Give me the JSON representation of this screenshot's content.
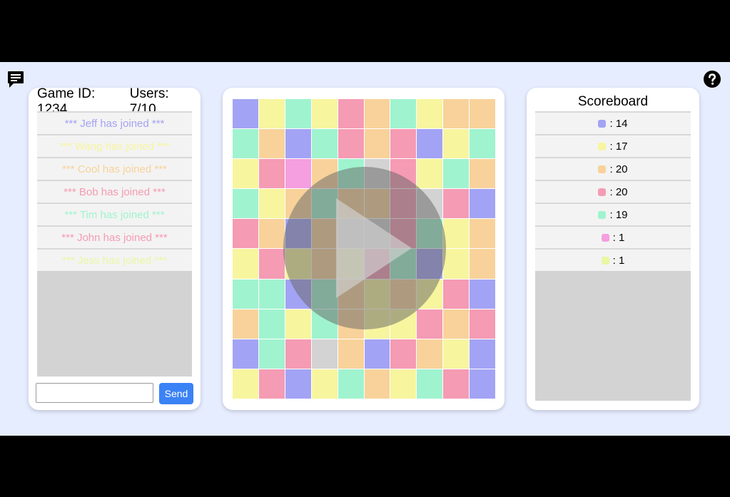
{
  "left_panel": {
    "game_label": "Game ID: 1234",
    "users_label": "Users: 7/10",
    "messages": [
      {
        "text": "*** Jeff has joined ***",
        "color": "#a3a3f5"
      },
      {
        "text": "*** Wang has joined ***",
        "color": "#f7f59e"
      },
      {
        "text": "*** Cool has joined ***",
        "color": "#f8d29a"
      },
      {
        "text": "*** Bob has joined ***",
        "color": "#f59bb4"
      },
      {
        "text": "*** Tim has joined ***",
        "color": "#a0f3cf"
      },
      {
        "text": "*** John has joined ***",
        "color": "#f59bb4"
      },
      {
        "text": "*** Jess has joined ***",
        "color": "#eaf7a3"
      }
    ],
    "chat_input_value": "",
    "send_label": "Send"
  },
  "scoreboard": {
    "title": "Scoreboard",
    "rows": [
      {
        "color": "#a3a3f5",
        "score": ": 14"
      },
      {
        "color": "#f7f59e",
        "score": ": 17"
      },
      {
        "color": "#f8d29a",
        "score": ": 20"
      },
      {
        "color": "#f59bb4",
        "score": ": 20"
      },
      {
        "color": "#a0f3cf",
        "score": ": 19"
      },
      {
        "color": "#f59ee0",
        "score": ": 1"
      },
      {
        "color": "#eaf7a3",
        "score": ": 1"
      }
    ]
  },
  "board": {
    "palette": {
      "P": "#a3a3f5",
      "Y": "#f7f59e",
      "M": "#a0f3cf",
      "O": "#f8d29a",
      "K": "#f59bb4",
      "U": "#f59ee0",
      "G": "#d3d3d3",
      "L": "#eaf7a3"
    },
    "rows": [
      "PYMYKOMYOO",
      "MOPMKOKPYM",
      "YKUOMGKYMO",
      "MYOMOOKGKP",
      "KOPOGGKMYO",
      "YKYOYKMPYO",
      "MMPMOYOYKP",
      "OMYMOYYKOK",
      "PMKGOPKOYP",
      "YKPYMOYMKP"
    ],
    "overlay": "play-icon"
  },
  "icons": {
    "chat": "chat-icon",
    "help": "help-icon"
  }
}
